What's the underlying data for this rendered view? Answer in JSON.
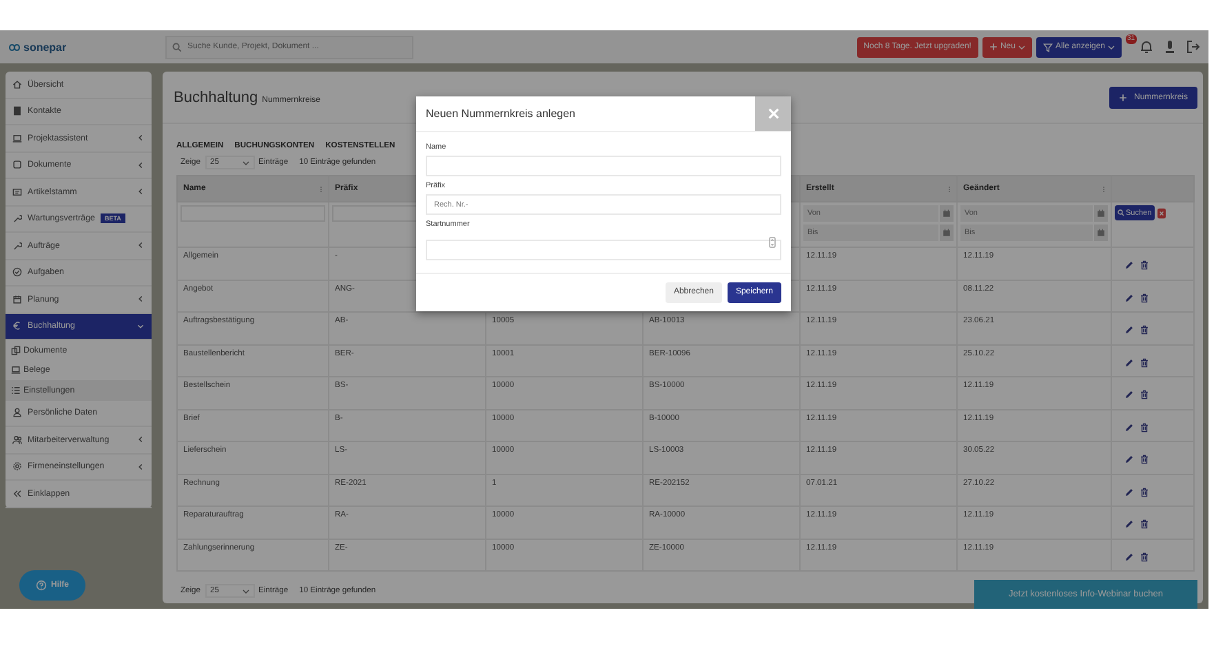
{
  "topbar": {
    "logo": "sonepar",
    "search_placeholder": "Suche Kunde, Projekt, Dokument ...",
    "trial_button": "Noch 8 Tage. Jetzt upgraden!",
    "new_button": "Neu",
    "filter_button": "Alle anzeigen",
    "notification_count": "31"
  },
  "sidebar": {
    "items": [
      {
        "label": "Übersicht"
      },
      {
        "label": "Kontakte"
      },
      {
        "label": "Projektassistent",
        "expanded": false
      },
      {
        "label": "Dokumente",
        "expanded": false
      },
      {
        "label": "Artikelstamm",
        "expanded": false
      },
      {
        "label": "Wartungsverträge",
        "badge": "BETA"
      },
      {
        "label": "Aufträge",
        "expanded": false
      },
      {
        "label": "Aufgaben"
      },
      {
        "label": "Planung",
        "expanded": false
      },
      {
        "label": "Buchhaltung",
        "expanded": true,
        "selected": true,
        "children": [
          {
            "label": "Dokumente",
            "selected": false
          },
          {
            "label": "Belege",
            "selected": false
          },
          {
            "label": "Einstellungen",
            "selected": true
          }
        ]
      },
      {
        "label": "Persönliche Daten"
      },
      {
        "label": "Mitarbeiterverwaltung",
        "expanded": false
      },
      {
        "label": "Firmeneinstellungen",
        "expanded": false
      },
      {
        "label": "Einklappen"
      }
    ]
  },
  "help_button": "Hilfe",
  "page": {
    "title": "Buchhaltung",
    "subtitle": "Nummernkreise",
    "add_button": "Nummernkreis",
    "tabs": [
      "ALLGEMEIN",
      "BUCHUNGSKONTEN",
      "KOSTENSTELLEN"
    ],
    "show_label": "Zeige",
    "page_size": "25",
    "entries_label": "Einträge",
    "found": "10 Einträge gefunden",
    "columns": [
      {
        "header": "Name",
        "kind": "text"
      },
      {
        "header": "Präfix",
        "kind": "text"
      },
      {
        "kind": "hidden"
      },
      {
        "kind": "hidden"
      },
      {
        "header": "Erstellt",
        "kind": "date",
        "date_fields": [
          {
            "placeholder": "Von"
          },
          {
            "placeholder": "Bis"
          }
        ]
      },
      {
        "header": "Geändert",
        "kind": "date",
        "date_fields": [
          {
            "placeholder": "Von"
          },
          {
            "placeholder": "Bis"
          }
        ]
      }
    ],
    "search_button": "Suchen",
    "rows": [
      [
        "Allgemein",
        "-",
        null,
        null,
        "12.11.19",
        "12.11.19"
      ],
      [
        "Angebot",
        "ANG-",
        null,
        null,
        "12.11.19",
        "08.11.22"
      ],
      [
        "Auftragsbestätigung",
        "AB-",
        "10005",
        "AB-10013",
        "12.11.19",
        "23.06.21"
      ],
      [
        "Baustellenbericht",
        "BER-",
        "10001",
        "BER-10096",
        "12.11.19",
        "25.10.22"
      ],
      [
        "Bestellschein",
        "BS-",
        "10000",
        "BS-10000",
        "12.11.19",
        "12.11.19"
      ],
      [
        "Brief",
        "B-",
        "10000",
        "B-10000",
        "12.11.19",
        "12.11.19"
      ],
      [
        "Lieferschein",
        "LS-",
        "10000",
        "LS-10003",
        "12.11.19",
        "30.05.22"
      ],
      [
        "Rechnung",
        "RE-2021",
        "1",
        "RE-202152",
        "07.01.21",
        "27.10.22"
      ],
      [
        "Reparaturauftrag",
        "RA-",
        "10000",
        "RA-10000",
        "12.11.19",
        "12.11.19"
      ],
      [
        "Zahlungserinnerung",
        "ZE-",
        "10000",
        "ZE-10000",
        "12.11.19",
        "12.11.19"
      ]
    ],
    "footer_show_label": "Zeige",
    "footer_page_size": "25",
    "footer_entries_label": "Einträge",
    "footer_found": "10 Einträge gefunden"
  },
  "webinar_button": "Jetzt kostenloses Info-Webinar buchen",
  "modal": {
    "title": "Neuen Nummernkreis anlegen",
    "fields": [
      {
        "label": "Name",
        "kind": "text"
      },
      {
        "label": "Präfix",
        "kind": "text",
        "placeholder": "Rech. Nr.-"
      },
      {
        "label": "Startnummer",
        "kind": "number"
      }
    ],
    "cancel": "Abbrechen",
    "save": "Speichern"
  }
}
